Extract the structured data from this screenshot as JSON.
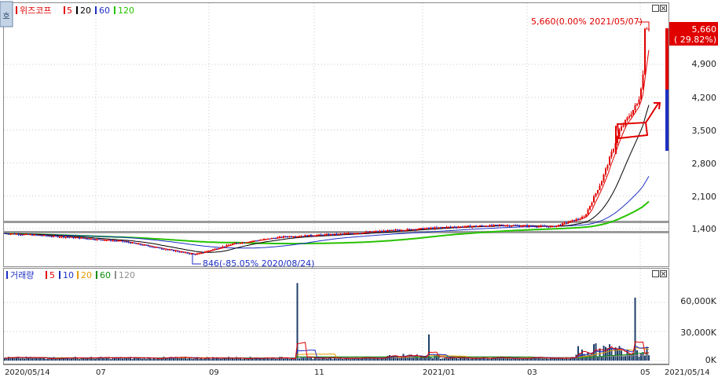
{
  "stock": {
    "name": "위즈코프"
  },
  "price_panel": {
    "legend": [
      {
        "label": "5",
        "color": "#e00000"
      },
      {
        "label": "20",
        "color": "#000000"
      },
      {
        "label": "60",
        "color": "#1d2fc4"
      },
      {
        "label": "120",
        "color": "#27c200"
      }
    ],
    "y_ticks": [
      "4,900",
      "4,200",
      "3,500",
      "2,800",
      "2,100",
      "1,400"
    ],
    "current_price": "5,660",
    "current_change": "( 29.82%)",
    "high_annotation": "5,660(0.00% 2021/05/07)",
    "low_annotation": "846(-85.05% 2020/08/24)"
  },
  "volume_panel": {
    "title": "거래량",
    "legend": [
      {
        "label": "5",
        "color": "#e00000"
      },
      {
        "label": "10",
        "color": "#1d2fc4"
      },
      {
        "label": "20",
        "color": "#e89a00"
      },
      {
        "label": "60",
        "color": "#108c10"
      },
      {
        "label": "120",
        "color": "#909090"
      }
    ],
    "y_ticks": [
      "60,000K",
      "30,000K",
      "0K"
    ]
  },
  "x_axis": {
    "labels": [
      "2020/05/14",
      "07",
      "09",
      "11",
      "2021/01",
      "03",
      "05",
      "2021/05/14"
    ]
  },
  "chart_data": {
    "type": "line",
    "title": "위즈코프",
    "price_axis_ticks": [
      1400,
      2100,
      2800,
      3500,
      4200,
      4900
    ],
    "price_close_series": [
      {
        "date": "2020/05/14",
        "close": 1300
      },
      {
        "date": "2020/06/15",
        "close": 1220
      },
      {
        "date": "2020/07/15",
        "close": 1130
      },
      {
        "date": "2020/08/24",
        "close": 846
      },
      {
        "date": "2020/09/15",
        "close": 1080
      },
      {
        "date": "2020/10/15",
        "close": 1230
      },
      {
        "date": "2020/11/15",
        "close": 1280
      },
      {
        "date": "2020/12/15",
        "close": 1360
      },
      {
        "date": "2021/01/15",
        "close": 1430
      },
      {
        "date": "2021/02/15",
        "close": 1470
      },
      {
        "date": "2021/03/15",
        "close": 1440
      },
      {
        "date": "2021/04/01",
        "close": 1650
      },
      {
        "date": "2021/04/10",
        "close": 2400
      },
      {
        "date": "2021/04/20",
        "close": 3500
      },
      {
        "date": "2021/04/30",
        "close": 4100
      },
      {
        "date": "2021/05/07",
        "close": 5660
      }
    ],
    "period_high": {
      "value": 5660,
      "change_pct": 0.0,
      "date": "2021/05/07"
    },
    "period_low": {
      "value": 846,
      "change_pct": -85.05,
      "date": "2020/08/24"
    },
    "current": {
      "value": 5660,
      "change_pct": 29.82
    },
    "volume_axis_ticks": [
      "0K",
      "30,000K",
      "60,000K"
    ],
    "volume_spikes": [
      {
        "date": "2020/10/22",
        "volume_k": 80000
      },
      {
        "date": "2021/01/05",
        "volume_k": 27000
      },
      {
        "date": "2021/04/28",
        "volume_k": 65000
      }
    ],
    "moving_averages": [
      "5",
      "20",
      "60",
      "120"
    ]
  }
}
